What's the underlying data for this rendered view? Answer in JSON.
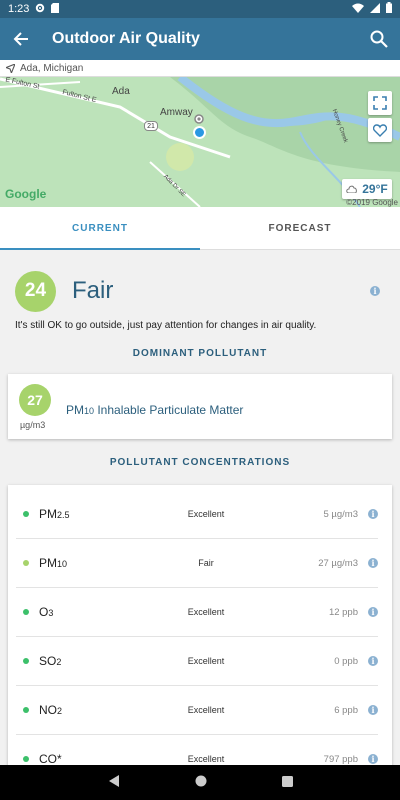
{
  "status_bar": {
    "time": "1:23"
  },
  "app_bar": {
    "title": "Outdoor Air Quality"
  },
  "location": {
    "name": "Ada, Michigan"
  },
  "map": {
    "labels": [
      "Ada",
      "Amway",
      "E Fulton St",
      "Fulton St E",
      "Honey Creek",
      "Ada Dr SE"
    ],
    "route_badge": "21",
    "google": "Google",
    "copyright": "©2019 Google",
    "temperature": "29°F"
  },
  "tabs": {
    "current": "CURRENT",
    "forecast": "FORECAST"
  },
  "aqi": {
    "value": "24",
    "label": "Fair",
    "description": "It's still OK to go outside, just pay attention for changes in air quality."
  },
  "dominant": {
    "heading": "DOMINANT POLLUTANT",
    "value": "27",
    "unit": "µg/m3",
    "name_prefix": "PM",
    "name_sub": "10",
    "name_rest": " Inhalable Particulate Matter"
  },
  "concentrations": {
    "heading": "POLLUTANT CONCENTRATIONS",
    "rows": [
      {
        "name": "PM",
        "sub": "2.5",
        "rating": "Excellent",
        "value": "5 µg/m3",
        "color": "#3cc06a"
      },
      {
        "name": "PM",
        "sub": "10",
        "rating": "Fair",
        "value": "27 µg/m3",
        "color": "#a7d36b"
      },
      {
        "name": "O",
        "sub": "3",
        "rating": "Excellent",
        "value": "12 ppb",
        "color": "#3cc06a"
      },
      {
        "name": "SO",
        "sub": "2",
        "rating": "Excellent",
        "value": "0 ppb",
        "color": "#3cc06a"
      },
      {
        "name": "NO",
        "sub": "2",
        "rating": "Excellent",
        "value": "6 ppb",
        "color": "#3cc06a"
      },
      {
        "name": "CO*",
        "sub": "",
        "rating": "Excellent",
        "value": "797 ppb",
        "color": "#3cc06a"
      }
    ]
  },
  "icons": [
    "back-arrow-icon",
    "search-icon",
    "location-arrow-icon",
    "fullscreen-icon",
    "favorite-heart-icon",
    "cloud-icon",
    "info-icon"
  ]
}
